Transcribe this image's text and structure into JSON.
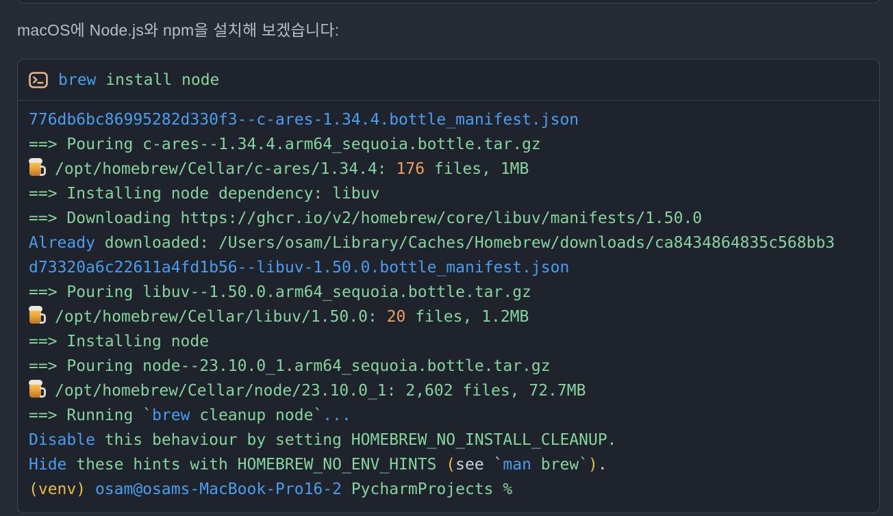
{
  "page": {
    "background": "#262b33"
  },
  "intro": {
    "text": "macOS에 Node.js와 npm을 설치해 보겠습니다:"
  },
  "palette": {
    "green": "#86d39e",
    "blue": "#4a9def",
    "orange": "#ef9e63",
    "yellow": "#e8bb49",
    "white": "#c9d1d9",
    "icon_orange": "#f0b48c",
    "intro_text": "#b6bec8",
    "block_bg": "#1f242c",
    "block_border": "#3b434e"
  },
  "terminal": {
    "header_icon": "terminal-icon",
    "command": [
      {
        "t": "brew",
        "c": "blue"
      },
      {
        "t": " install node",
        "c": "green"
      }
    ],
    "lines": [
      {
        "segments": [
          {
            "t": "776db6bc86995282d330f3--c-ares-1.34.4.bottle_manifest.json",
            "c": "blue"
          }
        ]
      },
      {
        "segments": [
          {
            "t": "==> Pouring c-ares--1.34.4.arm64_sequoia.bottle.tar.gz",
            "c": "green"
          }
        ]
      },
      {
        "segments": [
          {
            "i": "beer-icon"
          },
          {
            "t": "/opt/homebrew/Cellar/c-ares/1.34.4: ",
            "c": "green"
          },
          {
            "t": "176",
            "c": "orange"
          },
          {
            "t": " files, 1MB",
            "c": "green"
          }
        ]
      },
      {
        "segments": [
          {
            "t": "==> Installing node dependency: libuv",
            "c": "green"
          }
        ]
      },
      {
        "segments": [
          {
            "t": "==> Downloading https://ghcr.io/v2/homebrew/core/libuv/manifests/1.50.0",
            "c": "green"
          }
        ]
      },
      {
        "segments": [
          {
            "t": "Already",
            "c": "blue"
          },
          {
            "t": " downloaded: /Users/osam/Library/Caches/Homebrew/downloads/ca8434864835c568bb3",
            "c": "green"
          }
        ]
      },
      {
        "segments": [
          {
            "t": "d73320a6c22611a4fd1b56--libuv-1.50.0.bottle_manifest.json",
            "c": "blue"
          }
        ]
      },
      {
        "segments": [
          {
            "t": "==> Pouring libuv--1.50.0.arm64_sequoia.bottle.tar.gz",
            "c": "green"
          }
        ]
      },
      {
        "segments": [
          {
            "i": "beer-icon"
          },
          {
            "t": "/opt/homebrew/Cellar/libuv/1.50.0: ",
            "c": "green"
          },
          {
            "t": "20",
            "c": "orange"
          },
          {
            "t": " files, 1.2MB",
            "c": "green"
          }
        ]
      },
      {
        "segments": [
          {
            "t": "==> Installing node",
            "c": "green"
          }
        ]
      },
      {
        "segments": [
          {
            "t": "==> Pouring node--23.10.0_1.arm64_sequoia.bottle.tar.gz",
            "c": "green"
          }
        ]
      },
      {
        "segments": [
          {
            "i": "beer-icon"
          },
          {
            "t": "/opt/homebrew/Cellar/node/23.10.0_1: 2,602 files, 72.7MB",
            "c": "green"
          }
        ]
      },
      {
        "segments": [
          {
            "t": "==> Running `",
            "c": "green"
          },
          {
            "t": "brew",
            "c": "blue"
          },
          {
            "t": " cleanup node`",
            "c": "green"
          },
          {
            "t": "...",
            "c": "blue"
          }
        ]
      },
      {
        "segments": [
          {
            "t": "Disable",
            "c": "blue"
          },
          {
            "t": " this behaviour by setting HOMEBREW_NO_INSTALL_CLEANUP.",
            "c": "green"
          }
        ]
      },
      {
        "segments": [
          {
            "t": "Hide",
            "c": "blue"
          },
          {
            "t": " these hints with HOMEBREW_NO_ENV_HINTS ",
            "c": "green"
          },
          {
            "t": "(",
            "c": "yellow"
          },
          {
            "t": "see `",
            "c": "white"
          },
          {
            "t": "man",
            "c": "blue"
          },
          {
            "t": " brew`",
            "c": "green"
          },
          {
            "t": ")",
            "c": "yellow"
          },
          {
            "t": ".",
            "c": "white"
          }
        ]
      },
      {
        "segments": [
          {
            "t": "(venv)",
            "c": "yellow"
          },
          {
            "t": " osam@osams-MacBook-Pro16-2",
            "c": "blue"
          },
          {
            "t": " PycharmProjects %",
            "c": "green"
          }
        ]
      }
    ]
  }
}
